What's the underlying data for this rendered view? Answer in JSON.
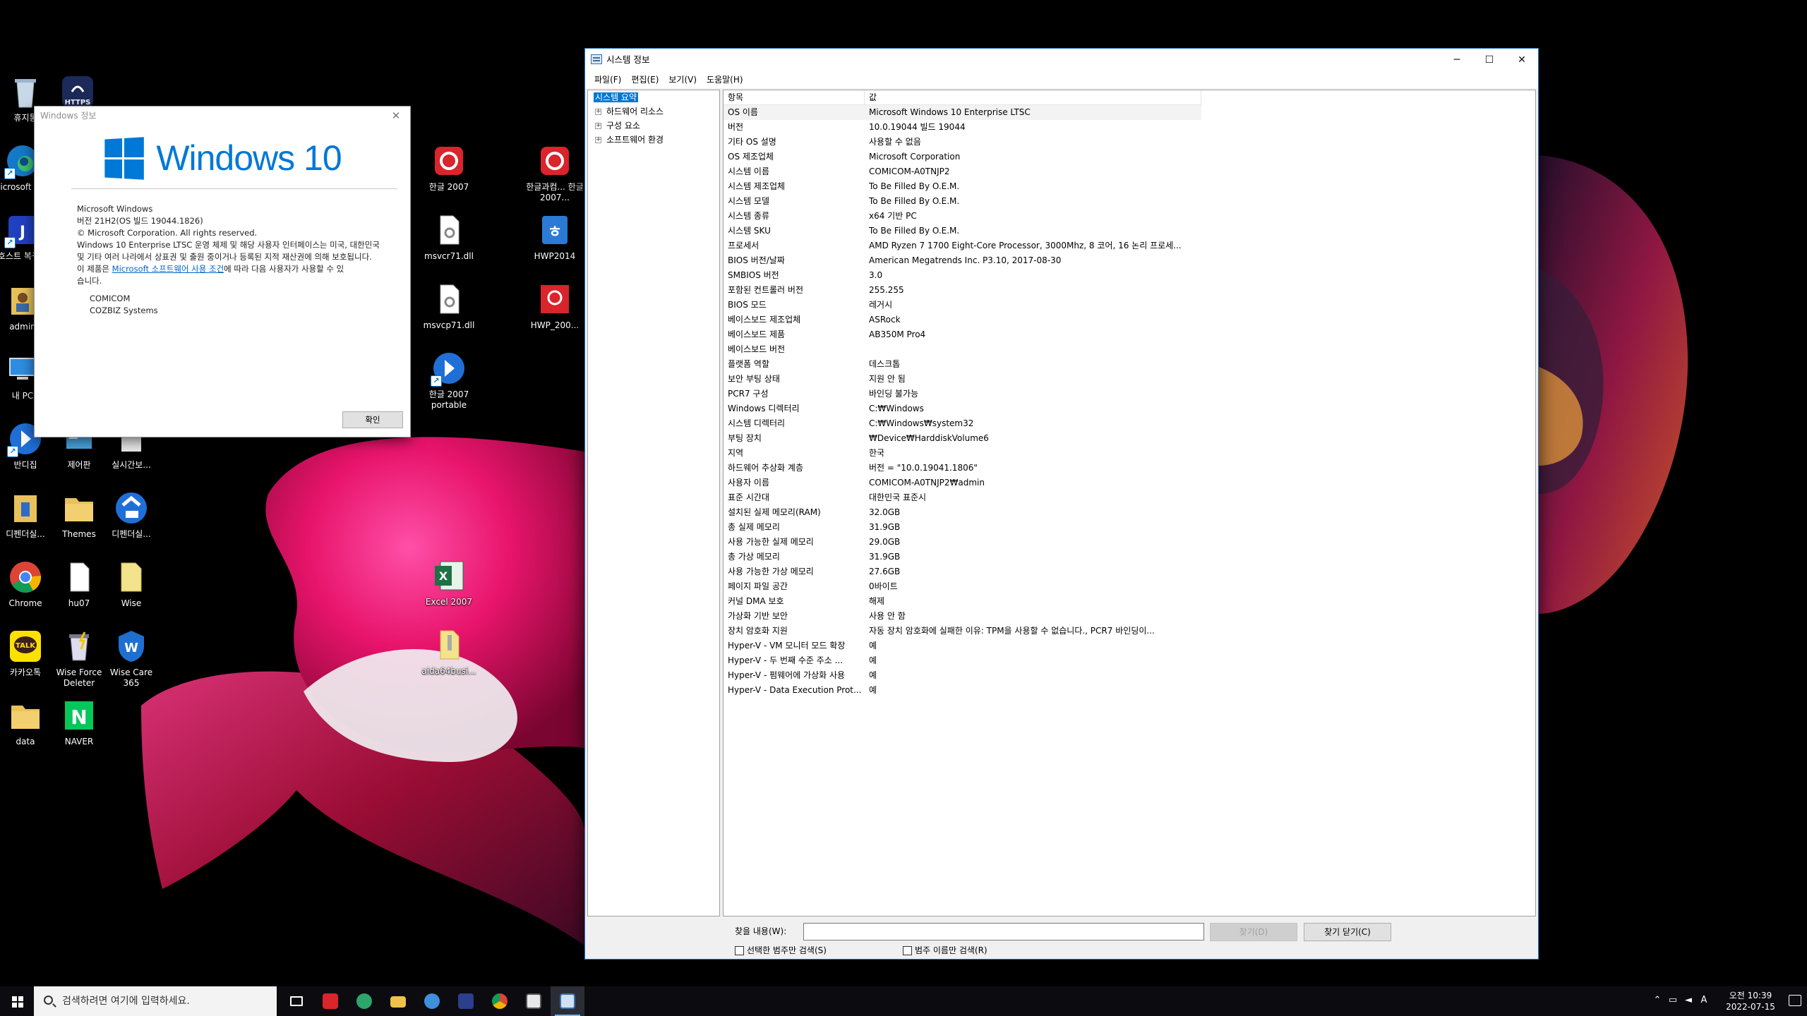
{
  "desktop_icons": [
    {
      "id": "recycle",
      "label": "휴지통",
      "icon": "recycle-bin-icon"
    },
    {
      "id": "https",
      "label": "HTTPS",
      "icon": "https-icon"
    },
    {
      "id": "edge",
      "label": "Microsoft Edge",
      "icon": "edge-icon"
    },
    {
      "id": "host",
      "label": "호스트 복귀하",
      "icon": "host-restore-icon"
    },
    {
      "id": "admin",
      "label": "admin",
      "icon": "user-folder-icon"
    },
    {
      "id": "mypc",
      "label": "내 PC",
      "icon": "this-pc-icon"
    },
    {
      "id": "bandizip",
      "label": "반디집",
      "icon": "bandizip-icon"
    },
    {
      "id": "control",
      "label": "제어판",
      "icon": "control-panel-icon"
    },
    {
      "id": "realtime",
      "label": "실시간보...",
      "icon": "realtime-backup-icon"
    },
    {
      "id": "defender1",
      "label": "디펜더실...",
      "icon": "defender-exec-icon"
    },
    {
      "id": "themes",
      "label": "Themes",
      "icon": "folder-icon"
    },
    {
      "id": "defender2",
      "label": "디펜더실...",
      "icon": "zip-shortcut-icon"
    },
    {
      "id": "chrome",
      "label": "Chrome",
      "icon": "chrome-icon"
    },
    {
      "id": "hu07",
      "label": "hu07",
      "icon": "document-icon"
    },
    {
      "id": "wise",
      "label": "Wise",
      "icon": "wise-folder-icon"
    },
    {
      "id": "kakao",
      "label": "카카오톡",
      "icon": "kakaotalk-icon"
    },
    {
      "id": "wiseforce",
      "label": "Wise Force Deleter",
      "icon": "wise-force-deleter-icon"
    },
    {
      "id": "wisecare",
      "label": "Wise Care 365",
      "icon": "wise-care-icon"
    },
    {
      "id": "data",
      "label": "data",
      "icon": "folder-icon"
    },
    {
      "id": "naver",
      "label": "NAVER",
      "icon": "naver-icon"
    },
    {
      "id": "hangul2007",
      "label": "한글 2007",
      "icon": "hangul-icon"
    },
    {
      "id": "hangulsci",
      "label": "한글과컴... 한글 2007...",
      "icon": "hangul-icon"
    },
    {
      "id": "msvcr71",
      "label": "msvcr71.dll",
      "icon": "dll-file-icon"
    },
    {
      "id": "hwp2014",
      "label": "HWP2014",
      "icon": "hwp-icon"
    },
    {
      "id": "msvcp71",
      "label": "msvcp71.dll",
      "icon": "dll-file-icon"
    },
    {
      "id": "hwp200",
      "label": "HWP_200...",
      "icon": "hwp-red-icon"
    },
    {
      "id": "hangulportable",
      "label": "한글 2007 portable",
      "icon": "zip-shortcut-icon"
    },
    {
      "id": "excel",
      "label": "Excel 2007",
      "icon": "excel-icon"
    },
    {
      "id": "aida",
      "label": "aida64busi...",
      "icon": "zip-file-icon"
    }
  ],
  "about": {
    "title": "Windows 정보",
    "logo_text": "Windows 10",
    "product": "Microsoft Windows",
    "version": "버전 21H2(OS 빌드 19044.1826)",
    "copyright": "© Microsoft Corporation. All rights reserved.",
    "legal": "Windows 10 Enterprise LTSC 운영 체제 및 해당 사용자 인터페이스는 미국, 대한민국 및 기타 여러 나라에서 상표권 및 출원 중이거나 등록된 지적 재산권에 의해 보호됩니다.",
    "license_pre": "이 제품은 ",
    "license_link": "Microsoft 소프트웨어 사용 조건",
    "license_post": "에 따라 다음 사용자가 사용할 수 있습니다.",
    "user1": "COMICOM",
    "user2": "COZBIZ Systems",
    "ok": "확인"
  },
  "sysinfo": {
    "title": "시스템 정보",
    "menu": [
      "파일(F)",
      "편집(E)",
      "보기(V)",
      "도움말(H)"
    ],
    "tree": {
      "root": "시스템 요약",
      "children": [
        "하드웨어 리소스",
        "구성 요소",
        "소프트웨어 환경"
      ]
    },
    "columns": [
      "항목",
      "값"
    ],
    "rows": [
      [
        "OS 이름",
        "Microsoft Windows 10 Enterprise LTSC"
      ],
      [
        "버전",
        "10.0.19044 빌드 19044"
      ],
      [
        "기타 OS 설명",
        "사용할 수 없음"
      ],
      [
        "OS 제조업체",
        "Microsoft Corporation"
      ],
      [
        "시스템 이름",
        "COMICOM-A0TNJP2"
      ],
      [
        "시스템 제조업체",
        "To Be Filled By O.E.M."
      ],
      [
        "시스템 모델",
        "To Be Filled By O.E.M."
      ],
      [
        "시스템 종류",
        "x64 기반 PC"
      ],
      [
        "시스템 SKU",
        "To Be Filled By O.E.M."
      ],
      [
        "프로세서",
        "AMD Ryzen 7 1700 Eight-Core Processor, 3000Mhz, 8 코어, 16 논리 프로세..."
      ],
      [
        "BIOS 버전/날짜",
        "American Megatrends Inc. P3.10, 2017-08-30"
      ],
      [
        "SMBIOS 버전",
        "3.0"
      ],
      [
        "포함된 컨트롤러 버전",
        "255.255"
      ],
      [
        "BIOS 모드",
        "레거시"
      ],
      [
        "베이스보드 제조업체",
        "ASRock"
      ],
      [
        "베이스보드 제품",
        "AB350M Pro4"
      ],
      [
        "베이스보드 버전",
        ""
      ],
      [
        "플랫폼 역할",
        "데스크톱"
      ],
      [
        "보안 부팅 상태",
        "지원 안 됨"
      ],
      [
        "PCR7 구성",
        "바인딩 불가능"
      ],
      [
        "Windows 디렉터리",
        "C:₩Windows"
      ],
      [
        "시스템 디렉터리",
        "C:₩Windows₩system32"
      ],
      [
        "부팅 장치",
        "₩Device₩HarddiskVolume6"
      ],
      [
        "지역",
        "한국"
      ],
      [
        "하드웨어 추상화 계층",
        "버전 = \"10.0.19041.1806\""
      ],
      [
        "사용자 이름",
        "COMICOM-A0TNJP2₩admin"
      ],
      [
        "표준 시간대",
        "대한민국 표준시"
      ],
      [
        "설치된 실제 메모리(RAM)",
        "32.0GB"
      ],
      [
        "총 실제 메모리",
        "31.9GB"
      ],
      [
        "사용 가능한 실제 메모리",
        "29.0GB"
      ],
      [
        "총 가상 메모리",
        "31.9GB"
      ],
      [
        "사용 가능한 가상 메모리",
        "27.6GB"
      ],
      [
        "페이지 파일 공간",
        "0바이트"
      ],
      [
        "커널 DMA 보호",
        "해제"
      ],
      [
        "가상화 기반 보안",
        "사용 안 함"
      ],
      [
        "장치 암호화 지원",
        "자동 장치 암호화에 실패한 이유: TPM을 사용할 수 없습니다., PCR7 바인딩이..."
      ],
      [
        "Hyper-V - VM 모니터 모드 확장",
        "예"
      ],
      [
        "Hyper-V - 두 번째 수준 주소 ...",
        "예"
      ],
      [
        "Hyper-V - 펌웨어에 가상화 사용",
        "예"
      ],
      [
        "Hyper-V - Data Execution Prot...",
        "예"
      ]
    ],
    "find_label": "찾을 내용(W):",
    "find_value": "",
    "find_button": "찾기(D)",
    "close_find_button": "찾기 닫기(C)",
    "check1": "선택한 범주만 검색(S)",
    "check2": "범주 이름만 검색(R)"
  },
  "taskbar": {
    "search_placeholder": "검색하려면 여기에 입력하세요.",
    "apps": [
      "task-view-icon",
      "hangul-icon",
      "edge-icon",
      "file-explorer-icon",
      "network-icon",
      "rufus-icon",
      "chrome-icon",
      "system-info-icon",
      "system-info-active-icon"
    ],
    "time": "오전 10:39",
    "date": "2022-07-15",
    "ime": "A"
  }
}
